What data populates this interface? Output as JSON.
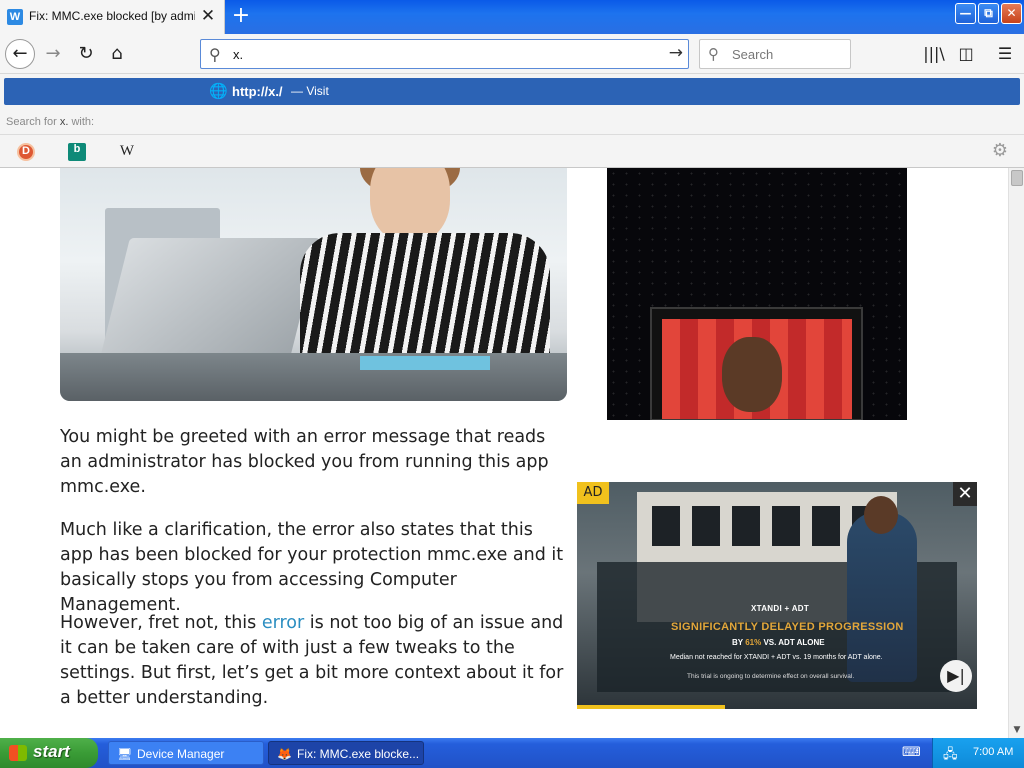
{
  "browser": {
    "tab": {
      "title": "Fix: MMC.exe blocked [by administrator]",
      "favicon_letter": "W"
    },
    "window_buttons": {
      "minimize": "—",
      "restore": "⧉",
      "close": "✕"
    },
    "url": "x.",
    "search_placeholder": "Search",
    "suggestion": {
      "url": "http://x./",
      "action": "— Visit"
    },
    "search_for": {
      "prefix": "Search for",
      "term": "x.",
      "suffix": "with:"
    },
    "engines": {
      "duckduckgo": "D",
      "bing": "b",
      "wikipedia": "W"
    }
  },
  "article": {
    "paragraph_1": "You might be greeted with an error message that reads an administrator has blocked you from running this app mmc.exe.",
    "paragraph_2": "Much like a clarification, the error also states that this app has been blocked for your protection mmc.exe and it basically stops you from accessing Computer Management.",
    "paragraph_3_before": "However, fret not, this ",
    "paragraph_3_link": "error",
    "paragraph_3_after": " is not too big of an issue and it can be taken care of with just a few tweaks to the settings. But first, let’s get a bit more context about it for a better understanding."
  },
  "ad": {
    "badge": "AD",
    "line1": "XTANDI + ADT",
    "line2": "SIGNIFICANTLY DELAYED PROGRESSION",
    "line3_prefix": "BY",
    "line3_highlight": "61%",
    "line3_suffix": "VS. ADT ALONE",
    "line4": "Median not reached for XTANDI + ADT vs. 19 months for ADT alone.",
    "line5": "This trial is ongoing to determine effect on overall survival.",
    "progress": 0.37
  },
  "taskbar": {
    "start": "start",
    "tasks": [
      {
        "label": "Device Manager"
      },
      {
        "label": "Fix: MMC.exe blocke..."
      }
    ],
    "time": "7:00 AM"
  },
  "colors": {
    "accent": "#2c63b5",
    "link": "#2b8ec1",
    "ad_gold": "#f0c11d"
  }
}
